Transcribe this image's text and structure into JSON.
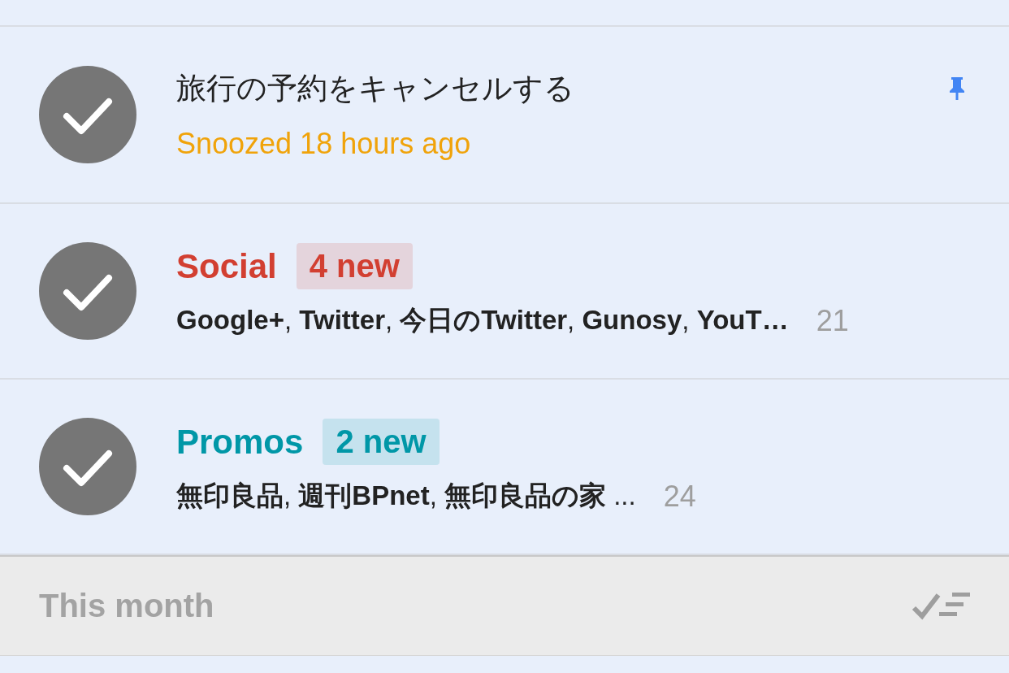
{
  "items": [
    {
      "kind": "reminder",
      "title": "旅行の予約をキャンセルする",
      "subtitle": "Snoozed 18 hours ago",
      "pinned": true
    },
    {
      "kind": "bundle",
      "name": "Social",
      "color": "#d23f31",
      "badge": "4 new",
      "summary": "**Google+**, **Twitter**, **今日のTwitter**, **Gunosy**, **YouT…**",
      "count": "21"
    },
    {
      "kind": "bundle",
      "name": "Promos",
      "color": "#0097a7",
      "badge": "2 new",
      "summary": "**無印良品**, **週刊BPnet**, **無印良品の家** ...",
      "count": "24"
    }
  ],
  "section": {
    "title": "This month"
  }
}
